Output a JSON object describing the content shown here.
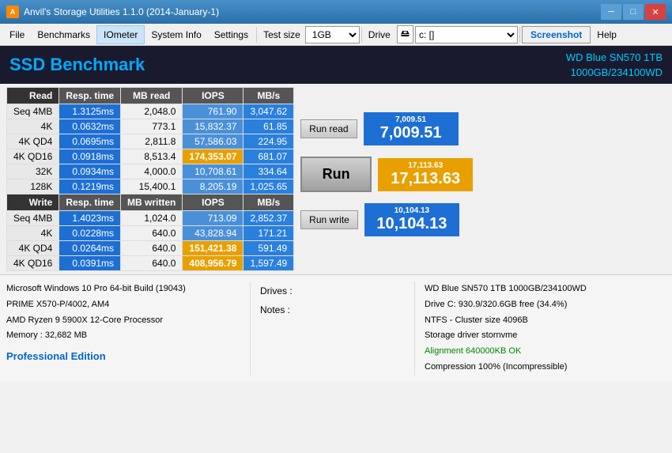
{
  "titlebar": {
    "title": "Anvil's Storage Utilities 1.1.0 (2014-January-1)",
    "minimize": "─",
    "maximize": "□",
    "close": "✕"
  },
  "menu": {
    "file": "File",
    "benchmarks": "Benchmarks",
    "iometer": "IOmeter",
    "systeminfo": "System Info",
    "settings": "Settings",
    "testsize_label": "Test size",
    "testsize_value": "1GB",
    "drive_label": "Drive",
    "drive_value": "c: []",
    "screenshot": "Screenshot",
    "help": "Help"
  },
  "header": {
    "title": "SSD Benchmark",
    "drive_name": "WD Blue SN570 1TB",
    "drive_detail": "1000GB/234100WD"
  },
  "read_table": {
    "headers": [
      "Read",
      "Resp. time",
      "MB read",
      "IOPS",
      "MB/s"
    ],
    "rows": [
      {
        "label": "Seq 4MB",
        "resp": "1.3125ms",
        "mb": "2,048.0",
        "iops": "761.90",
        "mbs": "3,047.62",
        "resp_class": "cell-blue",
        "iops_class": "cell-blue-light"
      },
      {
        "label": "4K",
        "resp": "0.0632ms",
        "mb": "773.1",
        "iops": "15,832.37",
        "mbs": "61.85",
        "resp_class": "cell-blue",
        "iops_class": "cell-blue-light"
      },
      {
        "label": "4K QD4",
        "resp": "0.0695ms",
        "mb": "2,811.8",
        "iops": "57,586.03",
        "mbs": "224.95",
        "resp_class": "cell-blue",
        "iops_class": "cell-blue-light"
      },
      {
        "label": "4K QD16",
        "resp": "0.0918ms",
        "mb": "8,513.4",
        "iops": "174,353.07",
        "mbs": "681.07",
        "resp_class": "cell-blue",
        "iops_class": "cell-orange"
      },
      {
        "label": "32K",
        "resp": "0.0934ms",
        "mb": "4,000.0",
        "iops": "10,708.61",
        "mbs": "334.64",
        "resp_class": "cell-blue",
        "iops_class": "cell-blue-light"
      },
      {
        "label": "128K",
        "resp": "0.1219ms",
        "mb": "15,400.1",
        "iops": "8,205.19",
        "mbs": "1,025.65",
        "resp_class": "cell-blue",
        "iops_class": "cell-blue-light"
      }
    ]
  },
  "write_table": {
    "headers": [
      "Write",
      "Resp. time",
      "MB written",
      "IOPS",
      "MB/s"
    ],
    "rows": [
      {
        "label": "Seq 4MB",
        "resp": "1.4023ms",
        "mb": "1,024.0",
        "iops": "713.09",
        "mbs": "2,852.37",
        "resp_class": "cell-blue",
        "iops_class": "cell-blue-light"
      },
      {
        "label": "4K",
        "resp": "0.0228ms",
        "mb": "640.0",
        "iops": "43,828.94",
        "mbs": "171.21",
        "resp_class": "cell-blue",
        "iops_class": "cell-blue-light"
      },
      {
        "label": "4K QD4",
        "resp": "0.0264ms",
        "mb": "640.0",
        "iops": "151,421.38",
        "mbs": "591.49",
        "resp_class": "cell-blue",
        "iops_class": "cell-orange"
      },
      {
        "label": "4K QD16",
        "resp": "0.0391ms",
        "mb": "640.0",
        "iops": "408,956.79",
        "mbs": "1,597.49",
        "resp_class": "cell-blue",
        "iops_class": "cell-orange"
      }
    ]
  },
  "scores": {
    "read_small": "7,009.51",
    "read_large": "7,009.51",
    "run_read": "Run read",
    "total_small": "17,113.63",
    "total_large": "17,113.63",
    "run_main": "Run",
    "write_small": "10,104.13",
    "write_large": "10,104.13",
    "run_write": "Run write"
  },
  "sysinfo": {
    "os": "Microsoft Windows 10 Pro 64-bit Build (19043)",
    "board": "PRIME X570-P/4002, AM4",
    "cpu": "AMD Ryzen 9 5900X 12-Core Processor",
    "memory": "Memory : 32,682 MB",
    "edition": "Professional Edition"
  },
  "drives_notes": {
    "drives_label": "Drives :",
    "notes_label": "Notes :"
  },
  "drive_detail": {
    "name": "WD Blue SN570 1TB 1000GB/234100WD",
    "drive_c": "Drive C: 930.9/320.6GB free (34.4%)",
    "fs": "NTFS - Cluster size 4096B",
    "storage": "Storage driver  stornvme",
    "alignment": "Alignment 640000KB OK",
    "compression": "Compression 100% (Incompressible)"
  }
}
